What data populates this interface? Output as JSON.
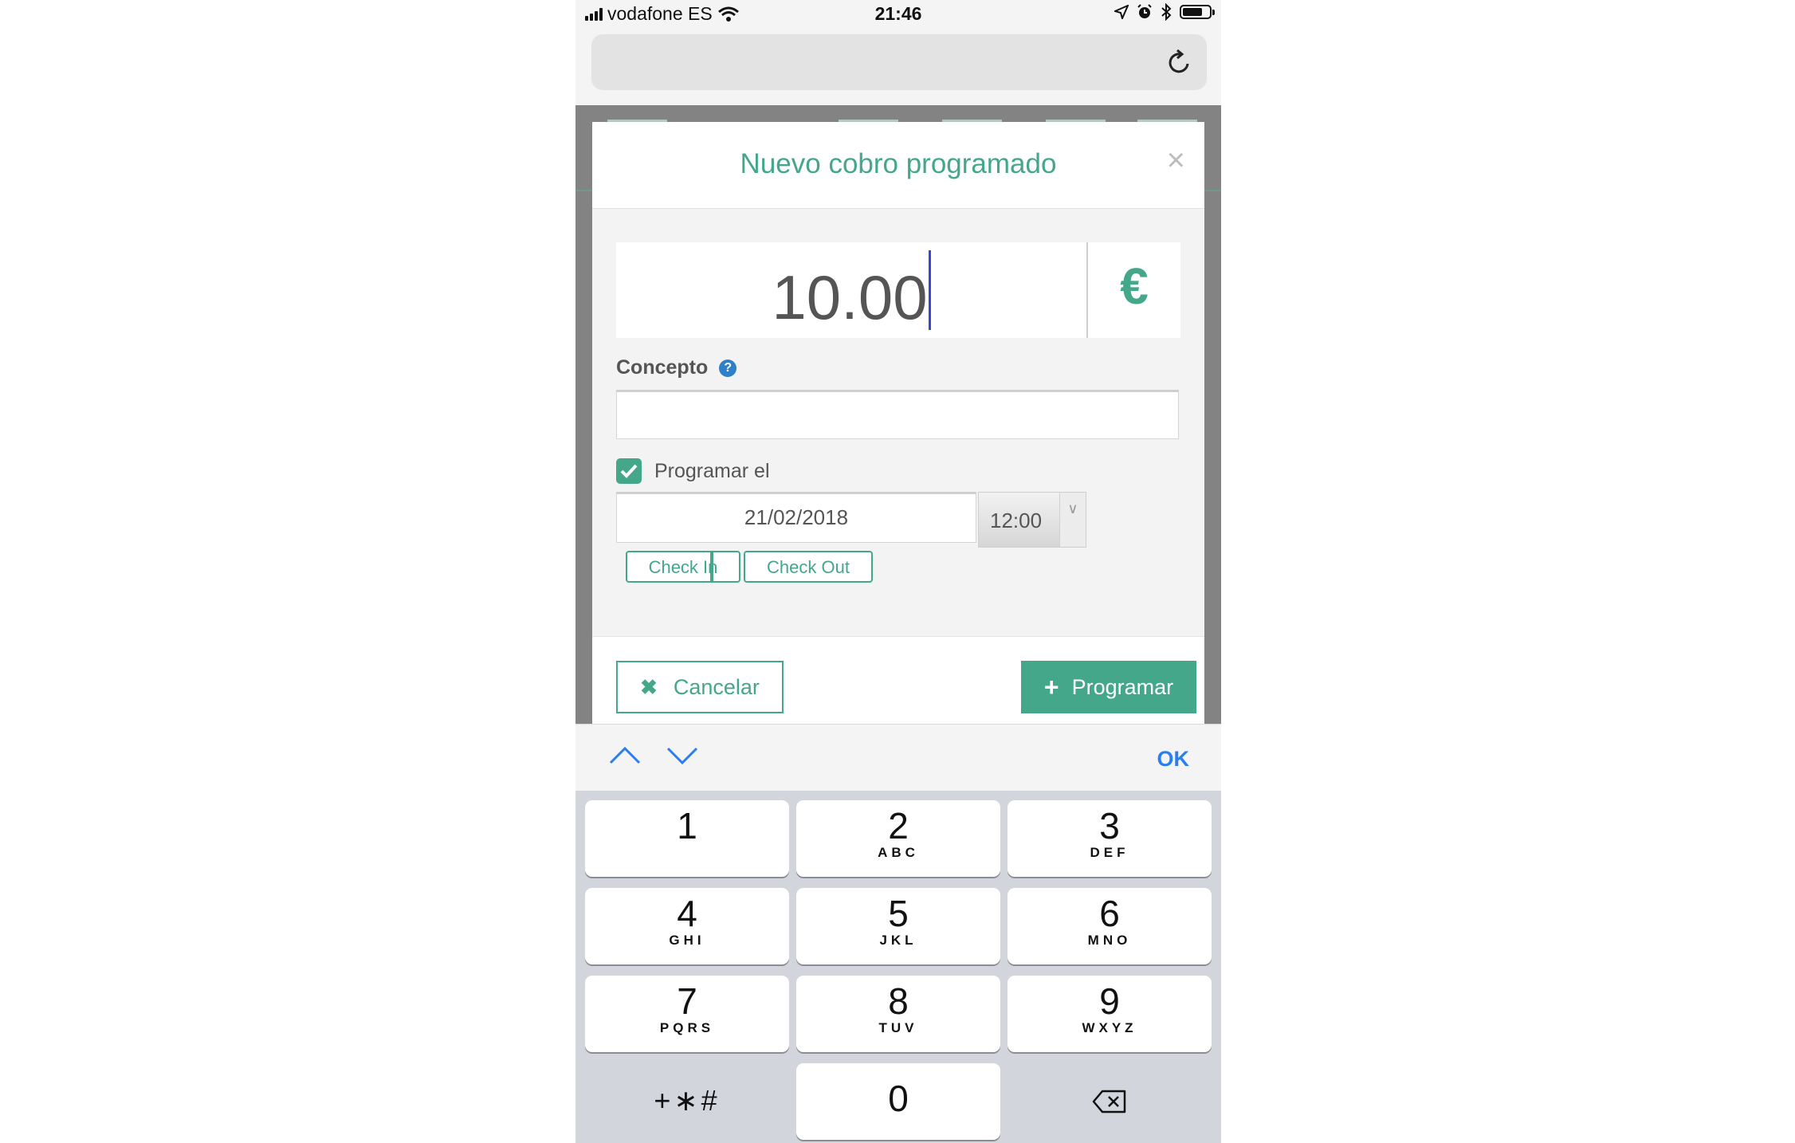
{
  "status_bar": {
    "carrier": "vodafone ES",
    "time": "21:46",
    "battery_level": 0.75
  },
  "browser": {
    "reload_icon": "reload-icon"
  },
  "modal": {
    "title": "Nuevo cobro programado",
    "close": "×",
    "amount": "10.00",
    "currency": "€",
    "concept_label": "Concepto",
    "concept_value": "",
    "schedule_checked": true,
    "schedule_label": "Programar el",
    "date": "21/02/2018",
    "time": "12:00",
    "check_in": "Check In",
    "check_out": "Check Out",
    "cancel": "Cancelar",
    "program": "Programar"
  },
  "keyboard": {
    "ok": "OK",
    "keys": [
      {
        "num": "1",
        "letters": ""
      },
      {
        "num": "2",
        "letters": "ABC"
      },
      {
        "num": "3",
        "letters": "DEF"
      },
      {
        "num": "4",
        "letters": "GHI"
      },
      {
        "num": "5",
        "letters": "JKL"
      },
      {
        "num": "6",
        "letters": "MNO"
      },
      {
        "num": "7",
        "letters": "PQRS"
      },
      {
        "num": "8",
        "letters": "TUV"
      },
      {
        "num": "9",
        "letters": "WXYZ"
      }
    ],
    "symbols": "+∗#",
    "zero": "0"
  },
  "colors": {
    "accent": "#45a78a",
    "link_blue": "#2a7ef2",
    "help_blue": "#2f80c8"
  }
}
